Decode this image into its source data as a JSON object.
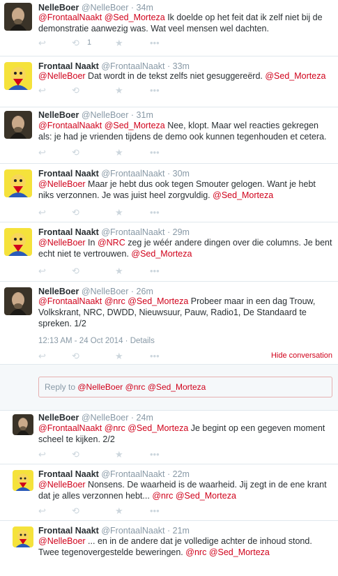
{
  "tweets": [
    {
      "name": "NelleBoer",
      "handle": "@NelleBoer",
      "time": "· 34m",
      "parts": [
        {
          "t": "@FrontaalNaakt",
          "m": true
        },
        {
          "t": " "
        },
        {
          "t": "@Sed_Morteza",
          "m": true
        },
        {
          "t": " Ik doelde op het feit dat ik zelf niet bij de demonstratie aanwezig was. Wat veel mensen wel dachten."
        }
      ],
      "retweets": "1"
    },
    {
      "name": "Frontaal Naakt",
      "handle": "@FrontaalNaakt",
      "time": "· 33m",
      "parts": [
        {
          "t": "@NelleBoer",
          "m": true
        },
        {
          "t": " Dat wordt in de tekst zelfs niet gesuggereërd. "
        },
        {
          "t": "@Sed_Morteza",
          "m": true
        }
      ]
    },
    {
      "name": "NelleBoer",
      "handle": "@NelleBoer",
      "time": "· 31m",
      "parts": [
        {
          "t": "@FrontaalNaakt",
          "m": true
        },
        {
          "t": " "
        },
        {
          "t": "@Sed_Morteza",
          "m": true
        },
        {
          "t": " Nee, klopt. Maar wel reacties gekregen als: je had je vrienden tijdens de demo ook kunnen tegenhouden et cetera."
        }
      ]
    },
    {
      "name": "Frontaal Naakt",
      "handle": "@FrontaalNaakt",
      "time": "· 30m",
      "parts": [
        {
          "t": "@NelleBoer",
          "m": true
        },
        {
          "t": " Maar je hebt dus ook tegen Smouter gelogen. Want je hebt niks verzonnen. Je was juist heel zorgvuldig. "
        },
        {
          "t": "@Sed_Morteza",
          "m": true
        }
      ]
    },
    {
      "name": "Frontaal Naakt",
      "handle": "@FrontaalNaakt",
      "time": "· 29m",
      "parts": [
        {
          "t": "@NelleBoer",
          "m": true
        },
        {
          "t": " In "
        },
        {
          "t": "@NRC",
          "m": true
        },
        {
          "t": " zeg je wéér andere dingen over die columns. Je bent echt niet te vertrouwen. "
        },
        {
          "t": "@Sed_Morteza",
          "m": true
        }
      ]
    },
    {
      "name": "NelleBoer",
      "handle": "@NelleBoer",
      "time": "· 26m",
      "parts": [
        {
          "t": "@FrontaalNaakt",
          "m": true
        },
        {
          "t": " "
        },
        {
          "t": "@nrc",
          "m": true
        },
        {
          "t": " "
        },
        {
          "t": "@Sed_Morteza",
          "m": true
        },
        {
          "t": " Probeer maar in een dag Trouw, Volkskrant, NRC, DWDD, Nieuwsuur, Pauw, Radio1, De Standaard te spreken. 1/2"
        }
      ]
    },
    {
      "name": "NelleBoer",
      "handle": "@NelleBoer",
      "time": "· 24m",
      "parts": [
        {
          "t": "@FrontaalNaakt",
          "m": true
        },
        {
          "t": " "
        },
        {
          "t": "@nrc",
          "m": true
        },
        {
          "t": " "
        },
        {
          "t": "@Sed_Morteza",
          "m": true
        },
        {
          "t": " Je begint op een gegeven moment scheel te kijken. 2/2"
        }
      ]
    },
    {
      "name": "Frontaal Naakt",
      "handle": "@FrontaalNaakt",
      "time": "· 22m",
      "parts": [
        {
          "t": "@NelleBoer",
          "m": true
        },
        {
          "t": " Nonsens. De waarheid is de waarheid. Jij zegt in de ene krant dat je alles verzonnen hebt... "
        },
        {
          "t": "@nrc",
          "m": true
        },
        {
          "t": " "
        },
        {
          "t": "@Sed_Morteza",
          "m": true
        }
      ]
    },
    {
      "name": "Frontaal Naakt",
      "handle": "@FrontaalNaakt",
      "time": "· 21m",
      "parts": [
        {
          "t": "@NelleBoer",
          "m": true
        },
        {
          "t": " ... en in de andere dat je volledige achter de inhoud stond. Twee tegenovergestelde beweringen. "
        },
        {
          "t": "@nrc",
          "m": true
        },
        {
          "t": " "
        },
        {
          "t": "@Sed_Morteza",
          "m": true
        }
      ]
    }
  ],
  "focused": {
    "timestamp": "12:13 AM - 24 Oct 2014",
    "details_label": "Details",
    "hide_label": "Hide conversation"
  },
  "reply": {
    "prefix": "Reply to ",
    "mentions": "@NelleBoer @nrc @Sed_Morteza"
  },
  "icons": {
    "reply": "reply-icon",
    "retweet": "retweet-icon",
    "favorite": "star-icon",
    "more": "more-icon"
  },
  "colors": {
    "mention": "#d0021b",
    "meta": "#8899a6",
    "icon": "#ccd6dd"
  }
}
